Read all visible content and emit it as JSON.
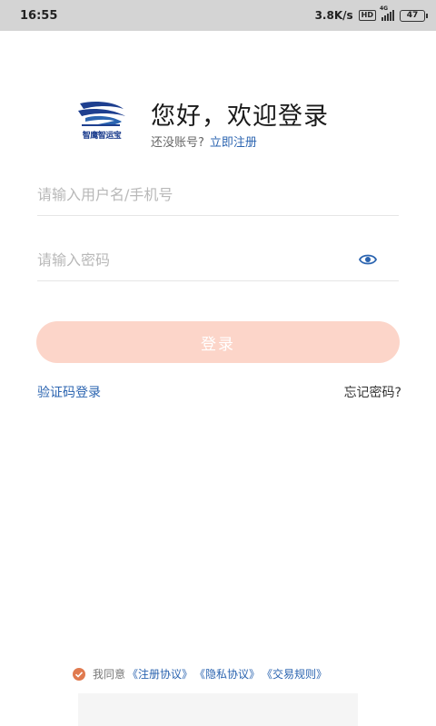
{
  "status_bar": {
    "time": "16:55",
    "net_speed": "3.8K/s",
    "hd": "HD",
    "network": "4G",
    "battery": "47"
  },
  "header": {
    "logo_text": "智鹰智运宝",
    "welcome": "您好，欢迎登录",
    "no_account": "还没账号?",
    "register_link": "立即注册"
  },
  "form": {
    "username_placeholder": "请输入用户名/手机号",
    "username_value": "",
    "password_placeholder": "请输入密码",
    "password_value": "",
    "login_label": "登录",
    "login_color": "#fcd5c9",
    "sms_login": "验证码登录",
    "forgot_password": "忘记密码?"
  },
  "agreement": {
    "prefix": "我同意",
    "checked": true,
    "check_color": "#e07a4f",
    "docs": [
      "《注册协议》",
      "《隐私协议》",
      "《交易规则》"
    ]
  },
  "colors": {
    "link": "#2b64b0",
    "brand": "#1e3f8f"
  }
}
